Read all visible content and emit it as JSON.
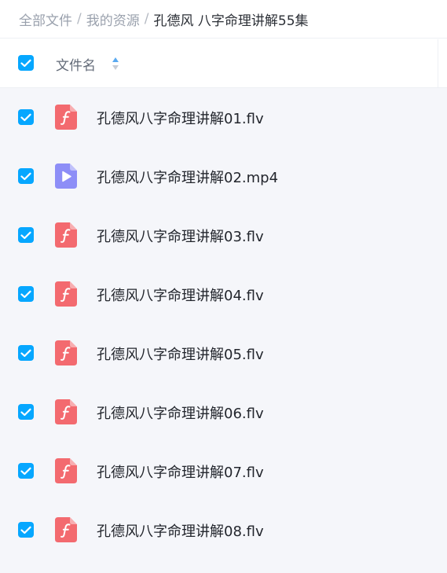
{
  "breadcrumb": {
    "items": [
      "全部文件",
      "我的资源"
    ],
    "separator": "/",
    "current": "孔德风 八字命理讲解55集"
  },
  "header": {
    "select_all_checked": true,
    "column_name": "文件名",
    "sort_icon": "sort-up-down-icon"
  },
  "colors": {
    "accent": "#06a7ff",
    "list_background": "#f5f6fa",
    "flash_icon": "#f36a6f",
    "video_icon": "#8d8ef7"
  },
  "files": [
    {
      "name": "孔德风八字命理讲解01.flv",
      "type": "flv",
      "icon": "flash-file-icon",
      "checked": true
    },
    {
      "name": "孔德风八字命理讲解02.mp4",
      "type": "mp4",
      "icon": "video-file-icon",
      "checked": true
    },
    {
      "name": "孔德风八字命理讲解03.flv",
      "type": "flv",
      "icon": "flash-file-icon",
      "checked": true
    },
    {
      "name": "孔德风八字命理讲解04.flv",
      "type": "flv",
      "icon": "flash-file-icon",
      "checked": true
    },
    {
      "name": "孔德风八字命理讲解05.flv",
      "type": "flv",
      "icon": "flash-file-icon",
      "checked": true
    },
    {
      "name": "孔德风八字命理讲解06.flv",
      "type": "flv",
      "icon": "flash-file-icon",
      "checked": true
    },
    {
      "name": "孔德风八字命理讲解07.flv",
      "type": "flv",
      "icon": "flash-file-icon",
      "checked": true
    },
    {
      "name": "孔德风八字命理讲解08.flv",
      "type": "flv",
      "icon": "flash-file-icon",
      "checked": true
    }
  ]
}
